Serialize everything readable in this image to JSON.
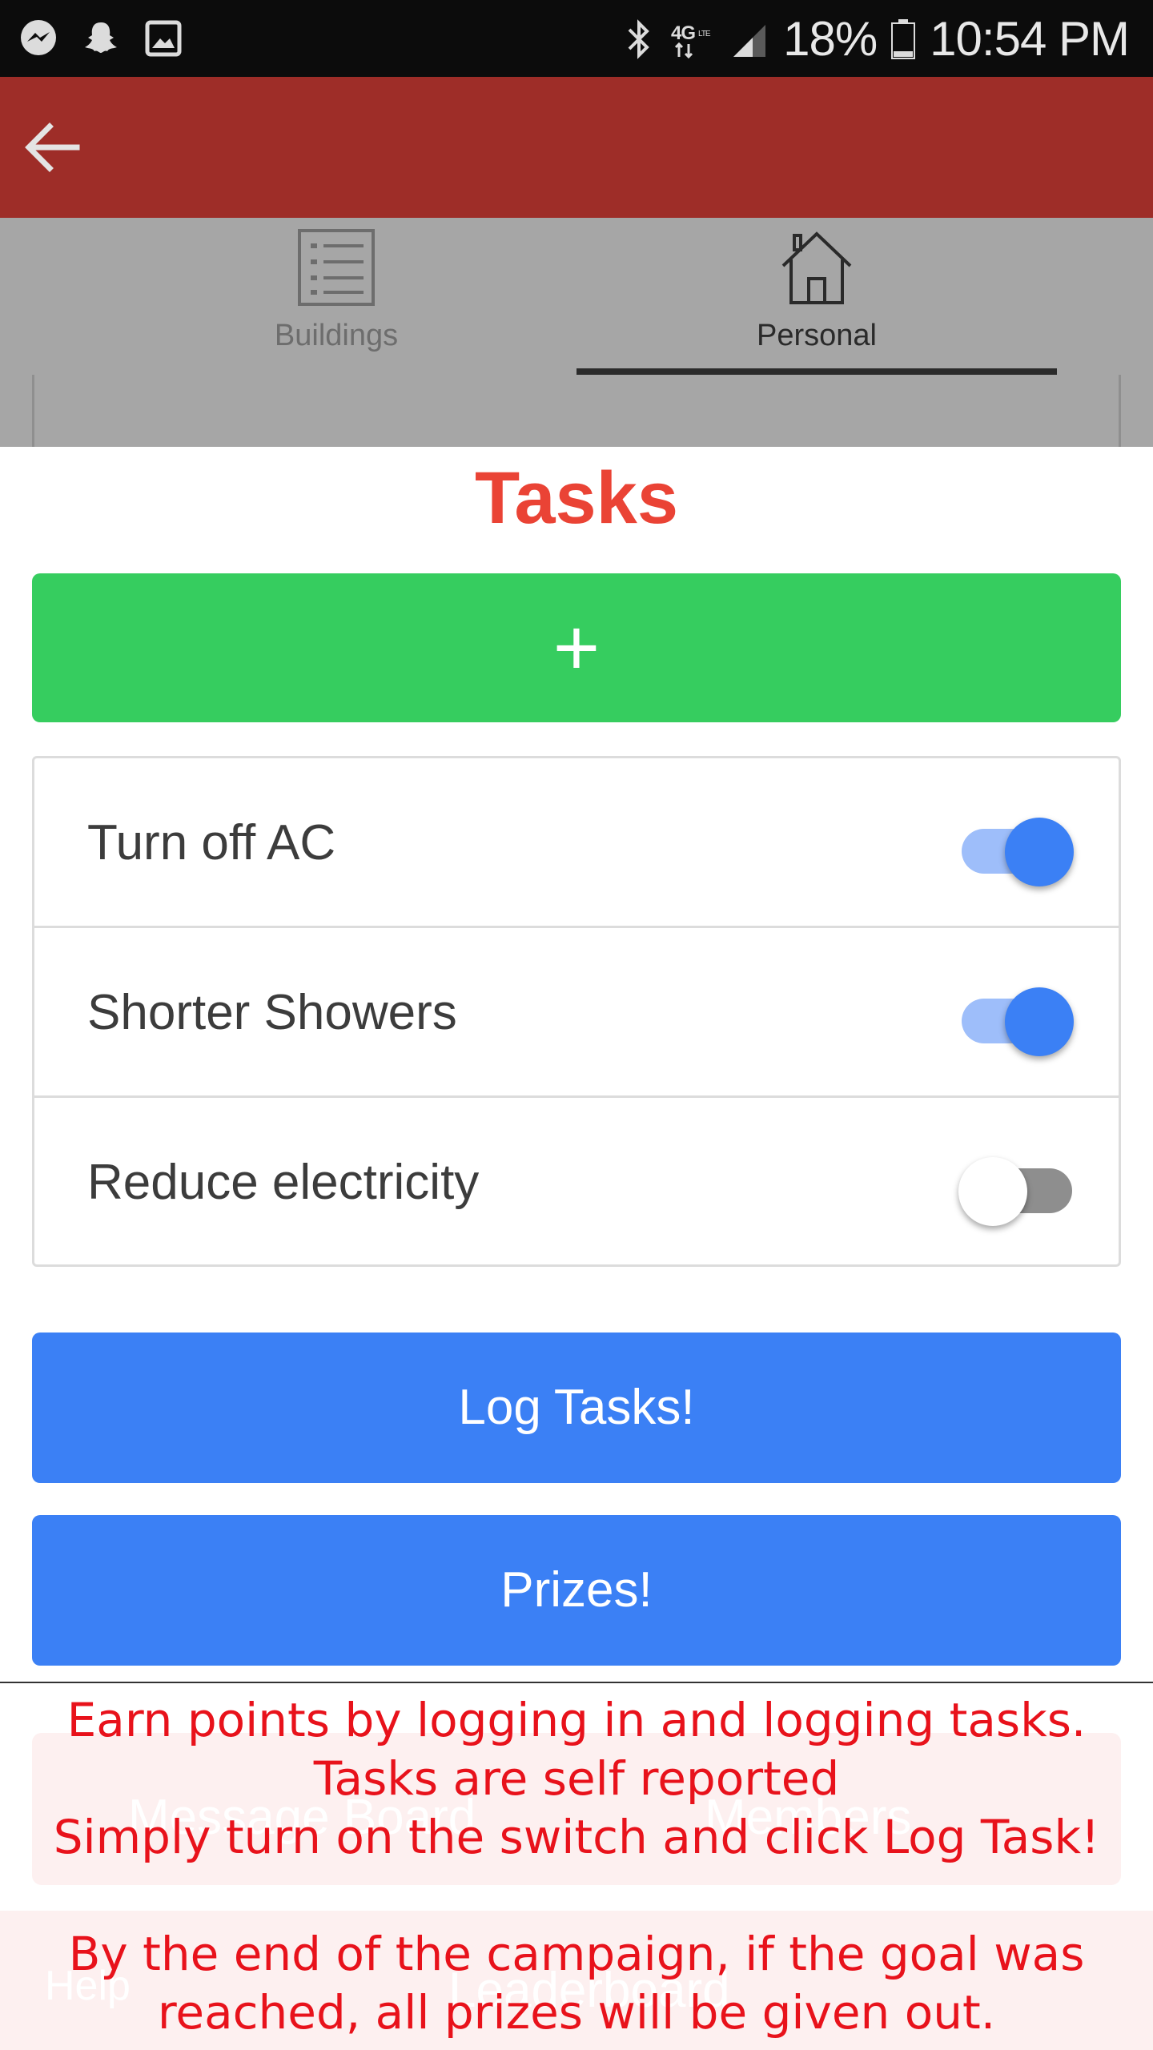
{
  "status_bar": {
    "left_icons": [
      "messenger-icon",
      "snapchat-icon",
      "gallery-icon"
    ],
    "network": "4G LTE",
    "battery": "18%",
    "time": "10:54 PM"
  },
  "app_bar": {
    "color": "#9e2d28",
    "back_icon": "arrow-left-icon"
  },
  "tabs": [
    {
      "label": "Buildings",
      "icon": "list-icon",
      "selected": false
    },
    {
      "label": "Personal",
      "icon": "house-icon",
      "selected": true
    }
  ],
  "modal": {
    "title": "Tasks",
    "add_button": {
      "label": "+",
      "color": "#36cd5f"
    },
    "tasks": [
      {
        "label": "Turn off AC",
        "enabled": true
      },
      {
        "label": "Shorter Showers",
        "enabled": true
      },
      {
        "label": "Reduce electricity",
        "enabled": false
      }
    ],
    "log_button": "Log Tasks!",
    "prizes_button": "Prizes!",
    "accent_blue": "#3b80f5"
  },
  "background_labels": {
    "row1_left": "Message Board",
    "row1_right": "Members",
    "row2_left": "Help",
    "row2_right": "Leaderboard"
  },
  "info_text": {
    "line1": "Earn points by logging in and logging tasks.",
    "line2": "Tasks are self reported",
    "line3": "Simply turn on the switch and click Log Task!",
    "line4": "By the end of the campaign, if the goal was",
    "line5": "reached, all prizes will be given out.",
    "color": "#e8121b"
  }
}
